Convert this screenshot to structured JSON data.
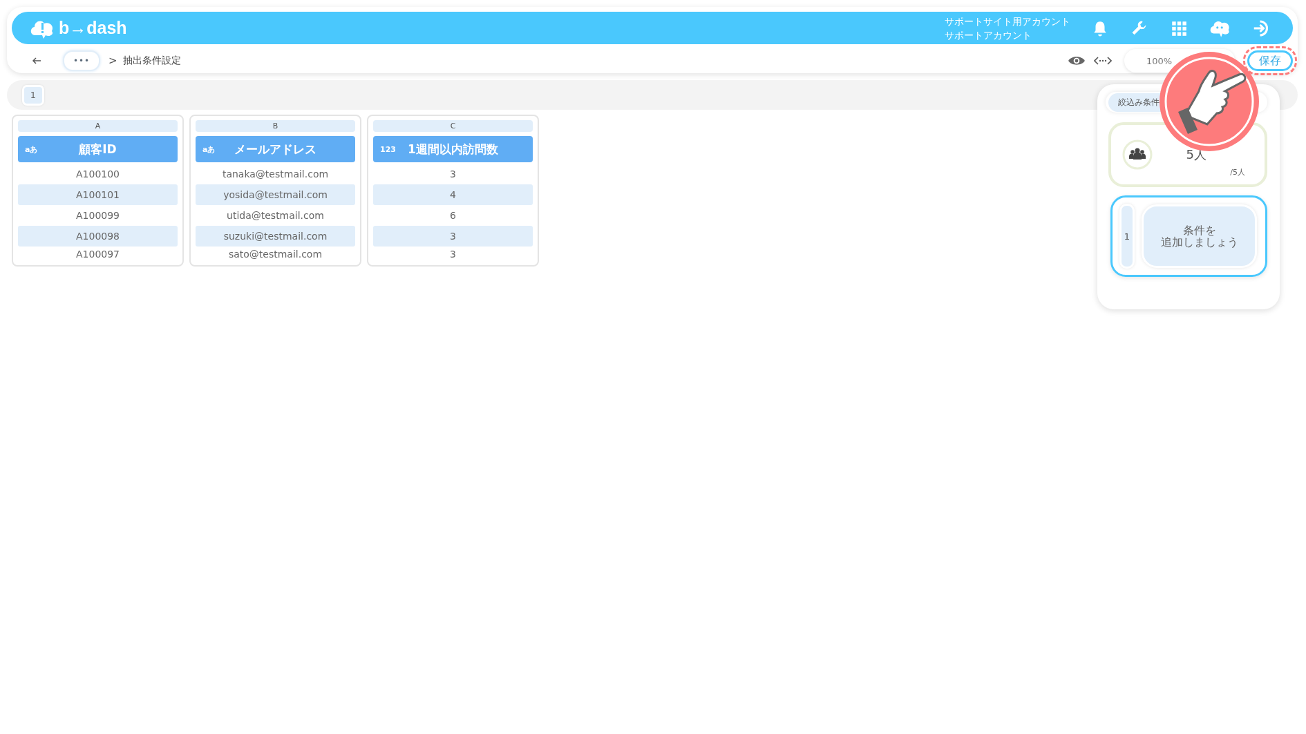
{
  "header": {
    "logo": "b→dash",
    "account_lines": [
      "サポートサイト用アカウント",
      "サポートアカウント"
    ]
  },
  "toolbar": {
    "more": "•••",
    "separator": ">",
    "breadcrumb": "抽出条件設定",
    "zoom": "100%",
    "save": "保存"
  },
  "sheet_tabs": [
    {
      "label": "1",
      "selected": true
    }
  ],
  "columns": [
    {
      "letter": "A",
      "type_badge": "aあ",
      "title": "顧客ID",
      "cells": [
        "A100100",
        "A100101",
        "A100099",
        "A100098",
        "A100097"
      ]
    },
    {
      "letter": "B",
      "type_badge": "aあ",
      "title": "メールアドレス",
      "cells": [
        "tanaka@testmail.com",
        "yosida@testmail.com",
        "utida@testmail.com",
        "suzuki@testmail.com",
        "sato@testmail.com"
      ]
    },
    {
      "letter": "C",
      "type_badge": "123",
      "title": "1週間以内訪問数",
      "cells": [
        "3",
        "4",
        "6",
        "3",
        "3"
      ]
    }
  ],
  "panel": {
    "tab": "絞込み条件",
    "count": "5人",
    "total": "/5人",
    "step": "1",
    "add_condition": [
      "条件を",
      "追加しましょう"
    ]
  },
  "save_highlighted": true
}
